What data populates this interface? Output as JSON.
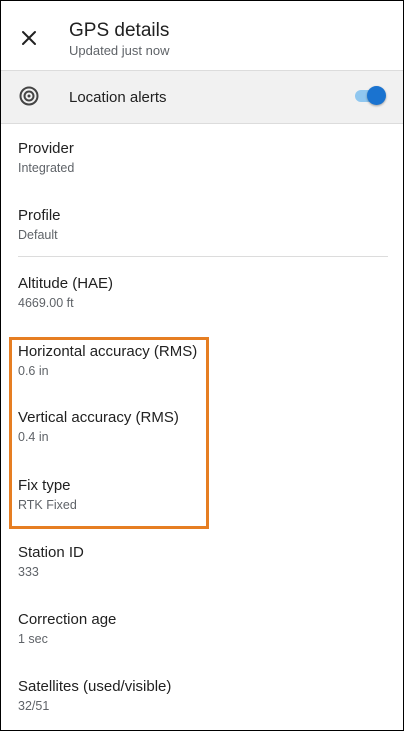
{
  "header": {
    "title": "GPS details",
    "subtitle": "Updated just now"
  },
  "alerts": {
    "label": "Location alerts",
    "enabled": true,
    "accent_color": "#1a73d0"
  },
  "details": [
    {
      "label": "Provider",
      "value": "Integrated"
    },
    {
      "label": "Profile",
      "value": "Default"
    },
    {
      "label": "Altitude (HAE)",
      "value": "4669.00 ft"
    },
    {
      "label": "Horizontal accuracy (RMS)",
      "value": "0.6 in"
    },
    {
      "label": "Vertical accuracy (RMS)",
      "value": "0.4 in"
    },
    {
      "label": "Fix type",
      "value": "RTK Fixed"
    },
    {
      "label": "Station ID",
      "value": "333"
    },
    {
      "label": "Correction age",
      "value": "1 sec"
    },
    {
      "label": "Satellites (used/visible)",
      "value": "32/51"
    }
  ],
  "highlight_color": "#e67e22"
}
